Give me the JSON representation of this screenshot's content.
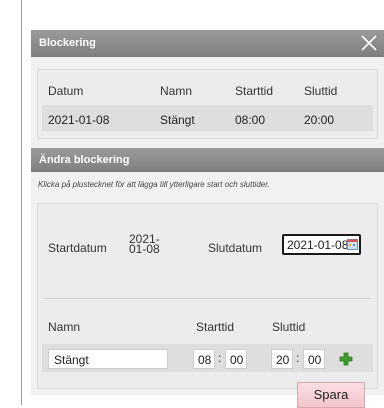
{
  "blockering": {
    "title": "Blockering",
    "columns": [
      "Datum",
      "Namn",
      "Starttid",
      "Sluttid"
    ],
    "row": [
      "2021-01-08",
      "Stängt",
      "08:00",
      "20:00"
    ]
  },
  "andra": {
    "title": "Ändra blockering",
    "hint": "Klicka på plustecknet för att lägga till ytterligare start och sluttider.",
    "startdatum_label": "Startdatum",
    "startdatum_value": "2021-01-08",
    "slutdatum_label": "Slutdatum",
    "slutdatum_value": "2021-01-08",
    "namn_label": "Namn",
    "starttid_label": "Starttid",
    "sluttid_label": "Sluttid",
    "namn_value": "Stängt",
    "start_hour": "08",
    "start_min": "00",
    "end_hour": "20",
    "end_min": "00",
    "time_separator": ":",
    "save_label": "Spara"
  },
  "icons": {
    "close": "close-icon",
    "calendar": "calendar-icon",
    "add": "plus-icon"
  },
  "colors": {
    "titlebar": "#8a8a8a",
    "save_button": "#f3c9cf",
    "add_icon": "#3e9a2e"
  }
}
